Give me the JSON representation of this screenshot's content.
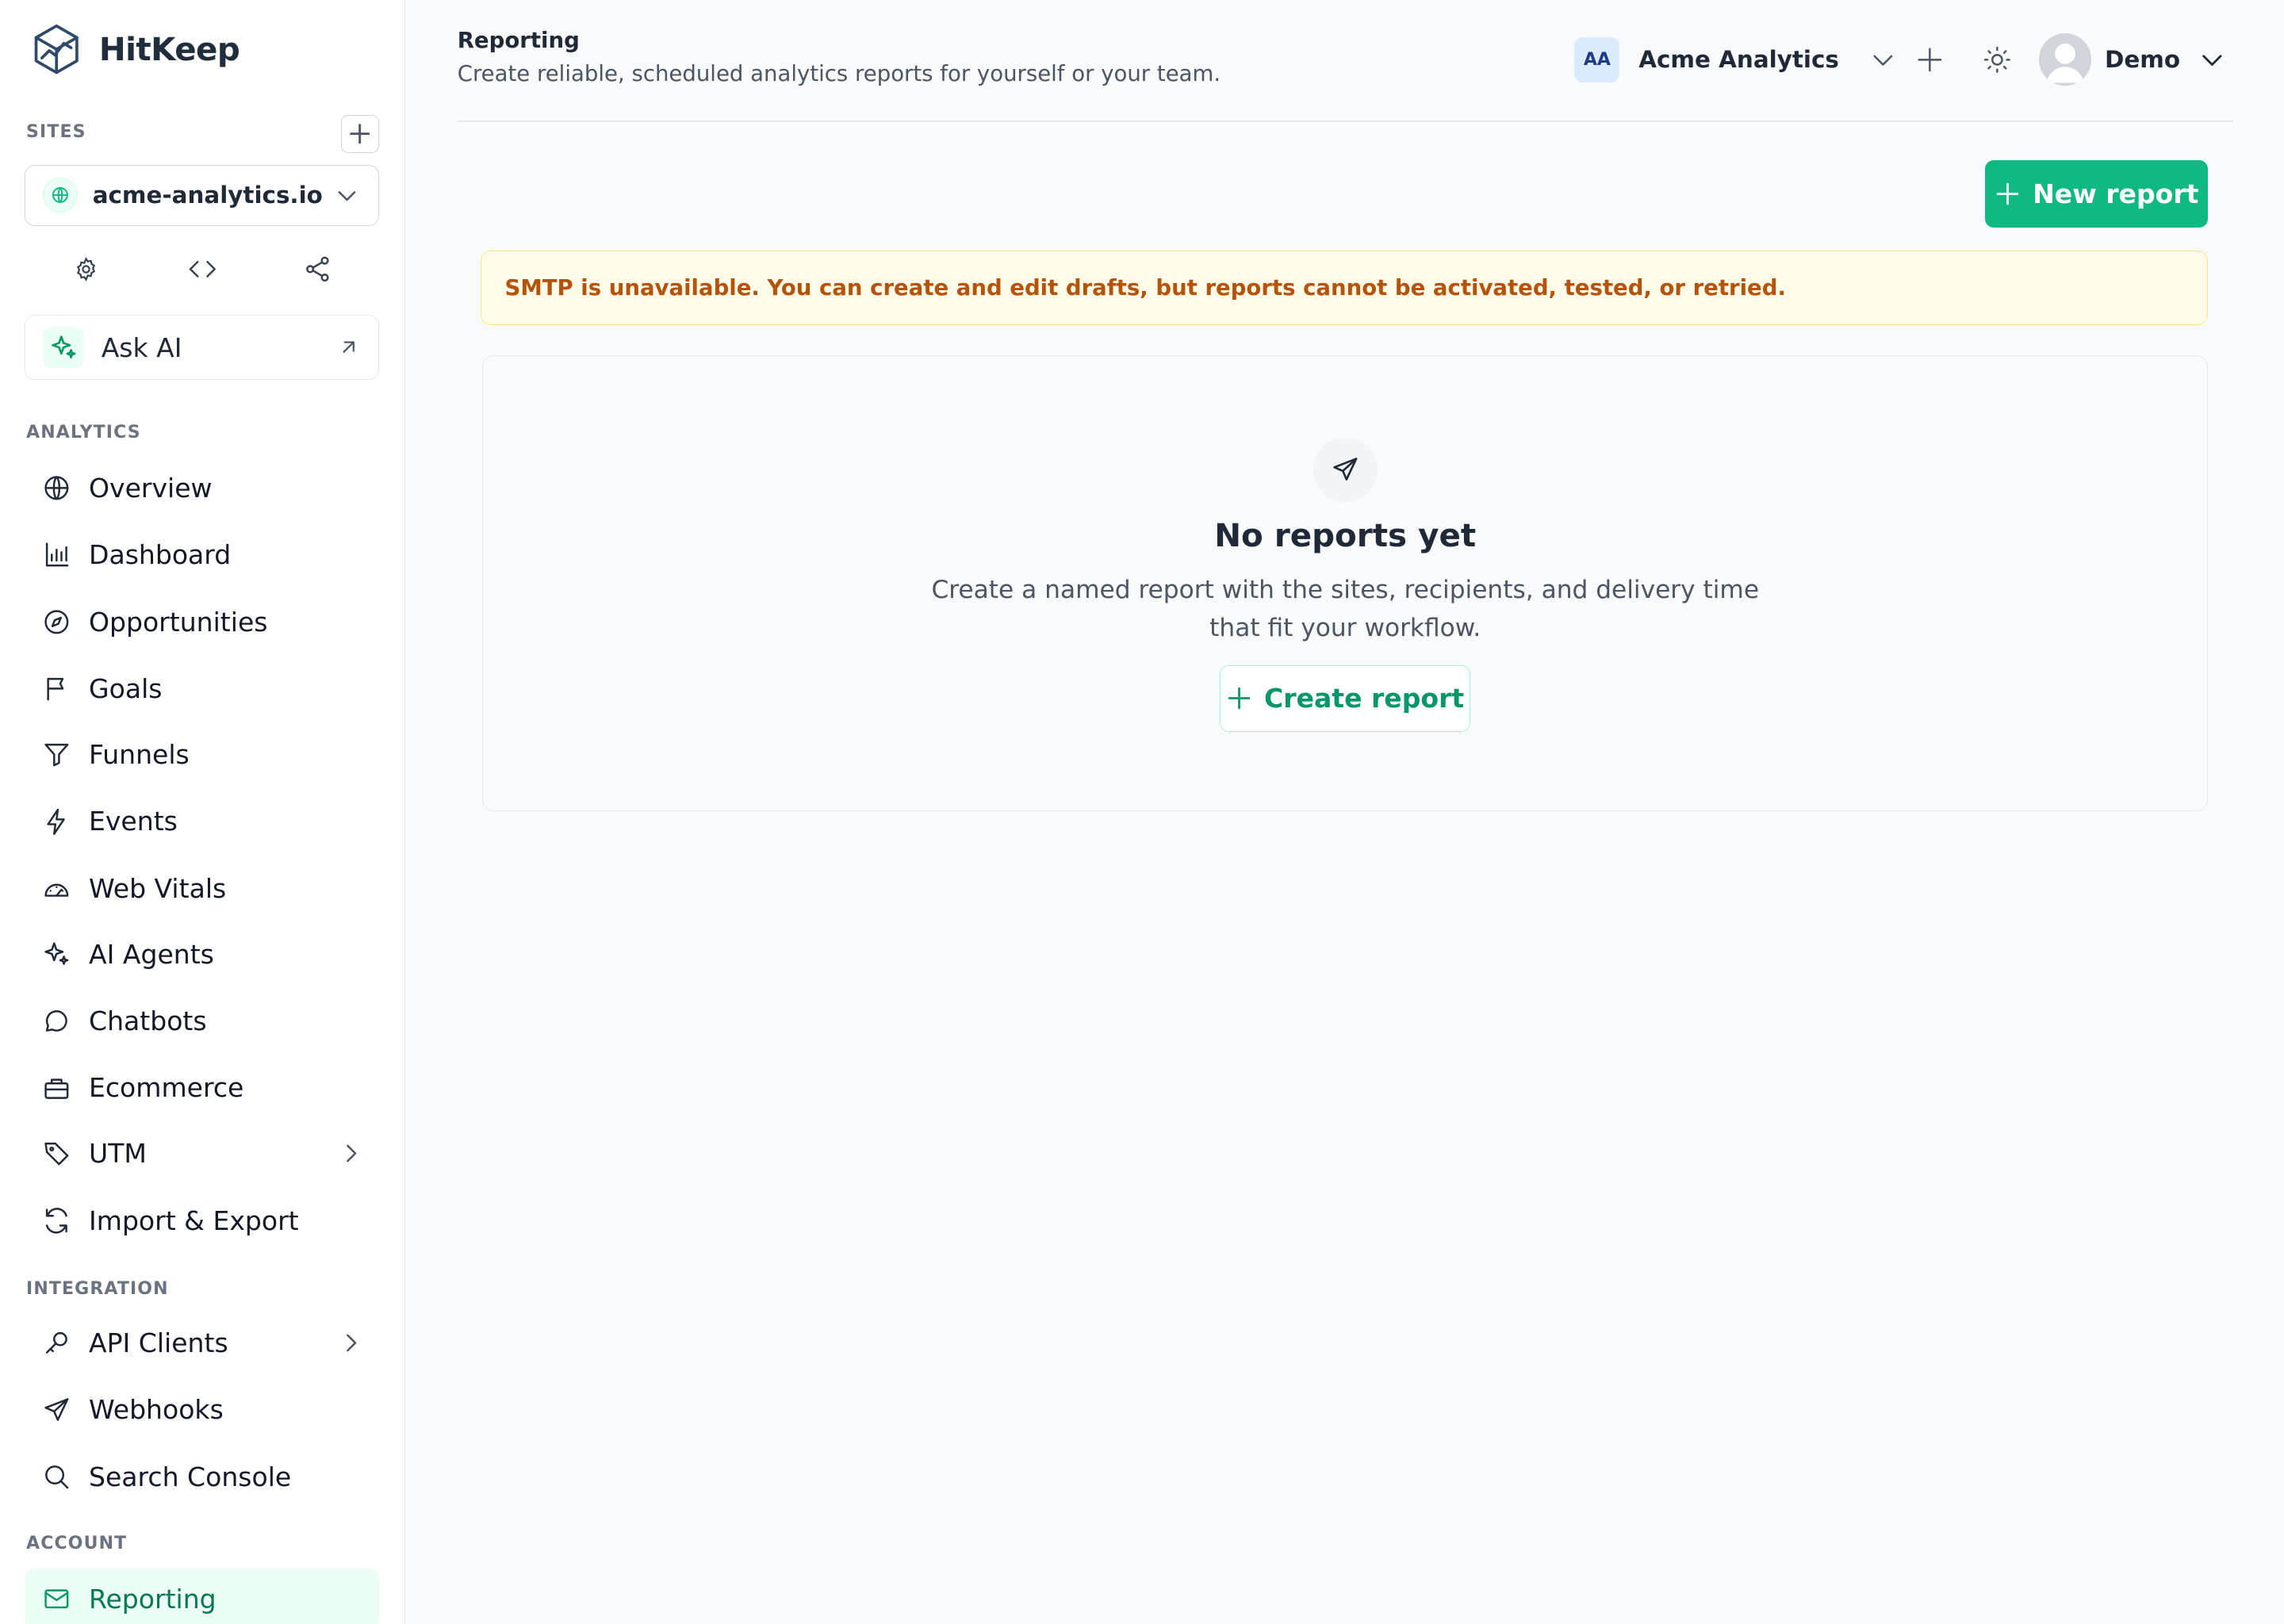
{
  "brand": {
    "name": "HitKeep"
  },
  "sidebar": {
    "sites_label": "SITES",
    "site_selected": "acme-analytics.io",
    "ask_ai_label": "Ask AI",
    "analytics_label": "ANALYTICS",
    "analytics_items": [
      {
        "label": "Overview",
        "icon": "globe-icon"
      },
      {
        "label": "Dashboard",
        "icon": "bar-chart-icon"
      },
      {
        "label": "Opportunities",
        "icon": "compass-icon"
      },
      {
        "label": "Goals",
        "icon": "flag-icon"
      },
      {
        "label": "Funnels",
        "icon": "funnel-icon"
      },
      {
        "label": "Events",
        "icon": "bolt-icon"
      },
      {
        "label": "Web Vitals",
        "icon": "gauge-icon"
      },
      {
        "label": "AI Agents",
        "icon": "sparkle-icon"
      },
      {
        "label": "Chatbots",
        "icon": "chat-icon"
      },
      {
        "label": "Ecommerce",
        "icon": "bag-icon"
      },
      {
        "label": "UTM",
        "icon": "tag-icon"
      },
      {
        "label": "Import & Export",
        "icon": "refresh-icon"
      }
    ],
    "integration_label": "INTEGRATION",
    "integration_items": [
      {
        "label": "API Clients",
        "icon": "key-icon"
      },
      {
        "label": "Webhooks",
        "icon": "send-icon"
      },
      {
        "label": "Search Console",
        "icon": "search-icon"
      }
    ],
    "account_label": "ACCOUNT",
    "account_items": [
      {
        "label": "Reporting",
        "icon": "mail-icon",
        "active": true
      }
    ]
  },
  "header": {
    "title": "Reporting",
    "subtitle": "Create reliable, scheduled analytics reports for yourself or your team.",
    "org_initials": "AA",
    "org_name": "Acme Analytics",
    "user_name": "Demo"
  },
  "main": {
    "new_report_label": "New report",
    "smtp_alert": "SMTP is unavailable. You can create and edit drafts, but reports cannot be activated, tested, or retried.",
    "empty_title": "No reports yet",
    "empty_description": "Create a named report with the sites, recipients, and delivery time that fit your workflow.",
    "create_report_label": "Create report"
  },
  "colors": {
    "accent": "#10b981",
    "accent_dark": "#059669",
    "warning_text": "#b45309",
    "warning_bg": "#fefce8"
  }
}
